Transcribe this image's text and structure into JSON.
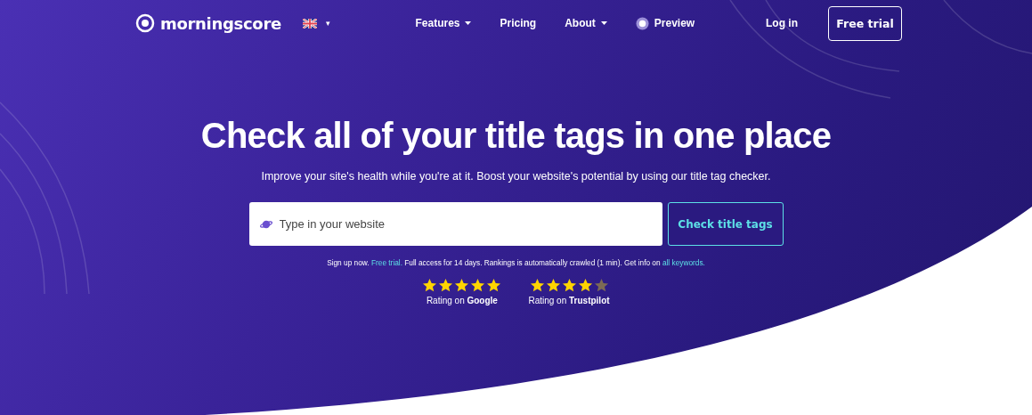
{
  "nav": {
    "logo": "morningscore",
    "language_caret": "▾",
    "items": [
      {
        "label": "Features",
        "dropdown": true
      },
      {
        "label": "Pricing",
        "dropdown": false
      },
      {
        "label": "About",
        "dropdown": true
      },
      {
        "label": "Preview",
        "dropdown": false,
        "kind": "preview"
      }
    ],
    "login": "Log in",
    "cta": "Free trial"
  },
  "hero": {
    "title": "Check all of your title tags in one place",
    "subtitle": "Improve your site's health while you're at it. Boost your website's potential by using our title tag checker.",
    "search": {
      "placeholder": "Type in your website",
      "button": "Check title tags"
    },
    "note": [
      {
        "kind": "text",
        "text": "Sign up now. "
      },
      {
        "kind": "link",
        "text": "Free trial."
      },
      {
        "kind": "text",
        "text": " Full access for 14 days. Rankings is automatically crawled (1 min). Get info on "
      },
      {
        "kind": "link",
        "text": "all keywords."
      }
    ],
    "ratings": [
      {
        "stars": 5,
        "label": "Rating on **Google**"
      },
      {
        "stars": 4,
        "label": "Rating on **Trustpilot**"
      }
    ]
  }
}
